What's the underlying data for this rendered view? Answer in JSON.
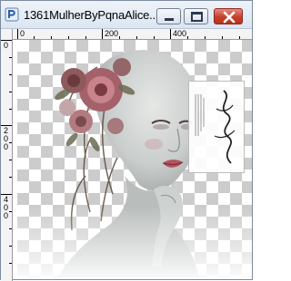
{
  "window": {
    "title": "1361MulherByPqnaAlice...",
    "app_icon": "psp-app-icon",
    "buttons": {
      "minimize": "minimize-icon",
      "maximize": "maximize-icon",
      "close": "close-icon"
    }
  },
  "rulers": {
    "horizontal_labels": [
      "0",
      "200",
      "400"
    ],
    "vertical_labels": [
      [
        "0"
      ],
      [
        "2",
        "0",
        "0"
      ],
      [
        "4",
        "0",
        "0"
      ]
    ]
  },
  "canvas": {
    "background": "transparency-checkerboard",
    "content": "woman-portrait-with-flowers",
    "watermark": "signature-watermark"
  },
  "colors": {
    "close_button": "#c4402f",
    "title_bar": "#dbe6f2",
    "checker_dark": "#cccccc",
    "checker_light": "#ffffff"
  }
}
